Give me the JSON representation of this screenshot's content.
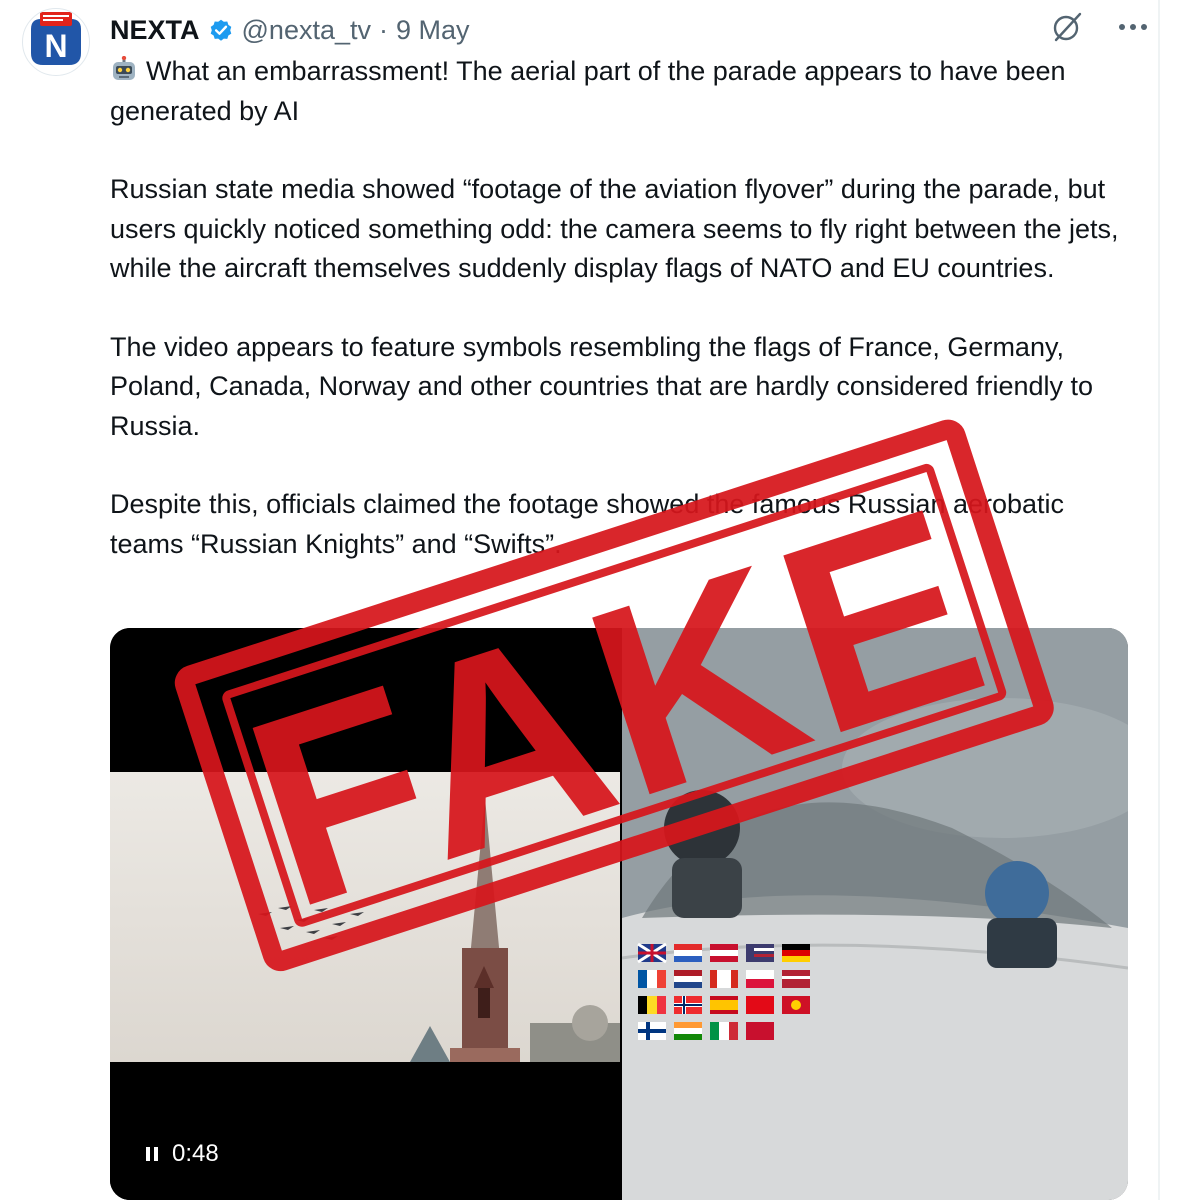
{
  "account": {
    "display_name": "NEXTA",
    "handle": "@nexta_tv",
    "separator": "·",
    "date": "9 May",
    "avatar_letter": "N"
  },
  "icons": {
    "avatar": "nexta-logo-icon",
    "verified": "verified-badge-icon",
    "grok": "grok-icon",
    "more": "more-dots-icon",
    "robot": "robot-emoji-icon",
    "pause": "pause-icon"
  },
  "tweet": {
    "paragraphs": [
      "What an embarrassment! The aerial part of the parade appears to have been generated by AI",
      "Russian state media showed “footage of the aviation flyover” during the parade, but users quickly noticed something odd: the camera seems to fly right between the jets, while the aircraft themselves suddenly display flags of NATO and EU countries.",
      "The video appears to feature symbols resembling the flags of France, Germany, Poland, Canada, Norway and other countries that are hardly considered friendly to Russia.",
      "Despite this, officials claimed the footage showed the famous Russian aerobatic teams “Russian Knights” and “Swifts”."
    ]
  },
  "video": {
    "timestamp": "0:48"
  },
  "stamp": {
    "text": "FAKE",
    "color": "#d7161c"
  },
  "colors": {
    "verified": "#1d9bf0",
    "text": "#0f1419",
    "secondary": "#536471",
    "brand": "#1a5fb4"
  }
}
